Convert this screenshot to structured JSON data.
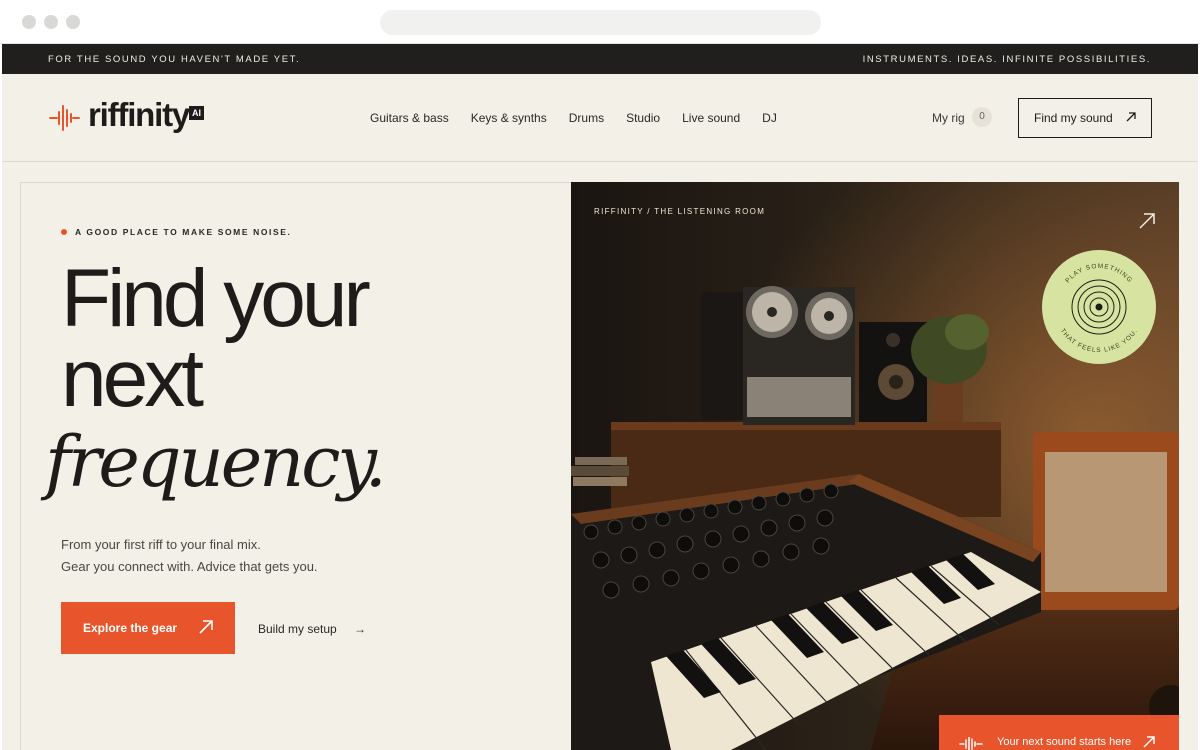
{
  "announcement": {
    "left": "FOR THE SOUND YOU HAVEN'T MADE YET.",
    "right": "INSTRUMENTS. IDEAS. INFINITE POSSIBILITIES."
  },
  "brand": {
    "name": "riffinity",
    "badge": "AI",
    "icon": "waveform-icon",
    "accent": "#e8542b"
  },
  "nav": [
    "Guitars & bass",
    "Keys & synths",
    "Drums",
    "Studio",
    "Live sound",
    "DJ"
  ],
  "header": {
    "rig_label": "My rig",
    "rig_count": "0",
    "cta": "Find my sound"
  },
  "hero": {
    "eyebrow": "A GOOD PLACE TO MAKE SOME NOISE.",
    "title_line1": "Find your",
    "title_line2": "next",
    "title_italic": "frequency.",
    "sub_line1": "From your first riff to your final mix.",
    "sub_line2": "Gear you connect with. Advice that gets you.",
    "primary_cta": "Explore the gear",
    "secondary_cta": "Build my setup"
  },
  "hero_image": {
    "caption": "RIFFINITY / THE LISTENING ROOM",
    "badge_text_top": "PLAY SOMETHING",
    "badge_text_bottom": "THAT FEELS LIKE YOU.",
    "badge_color": "#d7e3a0",
    "footer_cta": "Your next sound starts here"
  }
}
